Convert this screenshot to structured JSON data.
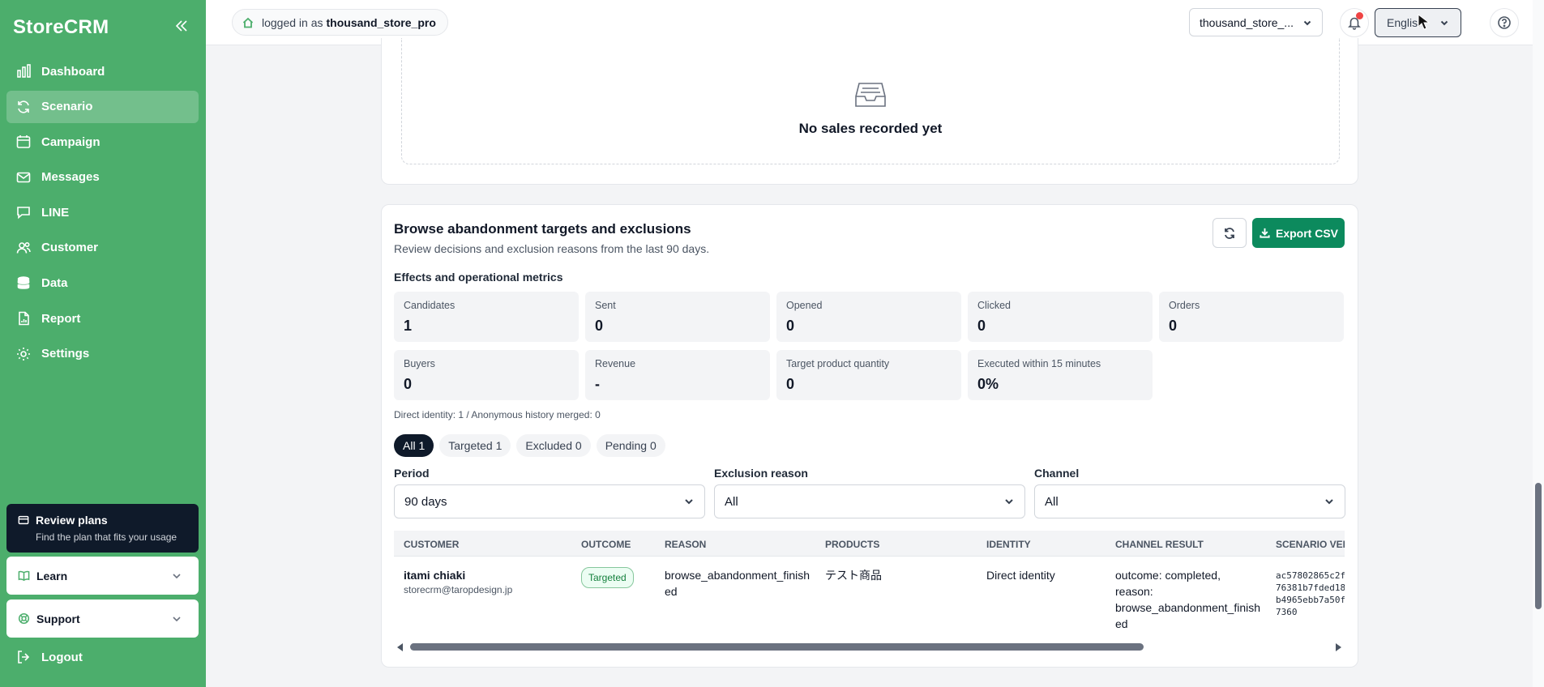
{
  "brand": "StoreCRM",
  "nav": [
    {
      "label": "Dashboard",
      "icon": "chart-bar-icon"
    },
    {
      "label": "Scenario",
      "icon": "refresh-cycle-icon",
      "active": true
    },
    {
      "label": "Campaign",
      "icon": "calendar-icon"
    },
    {
      "label": "Messages",
      "icon": "envelope-icon"
    },
    {
      "label": "LINE",
      "icon": "chat-bubble-icon"
    },
    {
      "label": "Customer",
      "icon": "users-icon"
    },
    {
      "label": "Data",
      "icon": "database-icon"
    },
    {
      "label": "Report",
      "icon": "document-icon"
    },
    {
      "label": "Settings",
      "icon": "gear-icon"
    }
  ],
  "plan": {
    "title": "Review plans",
    "subtitle": "Find the plan that fits your usage"
  },
  "learn_label": "Learn",
  "support_label": "Support",
  "logout_label": "Logout",
  "topbar": {
    "logged_in_prefix": "logged in as",
    "user": "thousand_store_pro",
    "store_selected": "thousand_store_...",
    "language": "English"
  },
  "empty_message": "No sales recorded yet",
  "browse": {
    "title": "Browse abandonment targets and exclusions",
    "subtitle": "Review decisions and exclusion reasons from the last 90 days.",
    "export_label": "Export CSV",
    "metrics_heading": "Effects and operational metrics",
    "metrics": [
      {
        "label": "Candidates",
        "value": "1"
      },
      {
        "label": "Sent",
        "value": "0"
      },
      {
        "label": "Opened",
        "value": "0"
      },
      {
        "label": "Clicked",
        "value": "0"
      },
      {
        "label": "Orders",
        "value": "0"
      },
      {
        "label": "Buyers",
        "value": "0"
      },
      {
        "label": "Revenue",
        "value": "-"
      },
      {
        "label": "Target product quantity",
        "value": "0"
      },
      {
        "label": "Executed within 15 minutes",
        "value": "0%"
      }
    ],
    "identity_note": "Direct identity: 1 / Anonymous history merged: 0",
    "filter_chips": [
      "All 1",
      "Targeted 1",
      "Excluded 0",
      "Pending 0"
    ],
    "period_label": "Period",
    "period_value": "90 days",
    "exclusion_label": "Exclusion reason",
    "exclusion_value": "All",
    "channel_label": "Channel",
    "channel_value": "All"
  },
  "table": {
    "headers": [
      "CUSTOMER",
      "OUTCOME",
      "REASON",
      "PRODUCTS",
      "IDENTITY",
      "CHANNEL RESULT",
      "SCENARIO VER"
    ],
    "row": {
      "customer_name": "itami chiaki",
      "customer_email": "storecrm@taropdesign.jp",
      "outcome": "Targeted",
      "reason_l1": "browse_abandonment_finish",
      "reason_l2": "ed",
      "products": "テスト商品",
      "identity": "Direct identity",
      "channel_l1": "outcome: completed,",
      "channel_l2": "reason:",
      "channel_l3": "browse_abandonment_finish",
      "channel_l4": "ed",
      "ver_l1": "ac57802865c2f",
      "ver_l2": "76381b7fded18",
      "ver_l3": "b4965ebb7a50f",
      "ver_l4": "7360"
    }
  }
}
